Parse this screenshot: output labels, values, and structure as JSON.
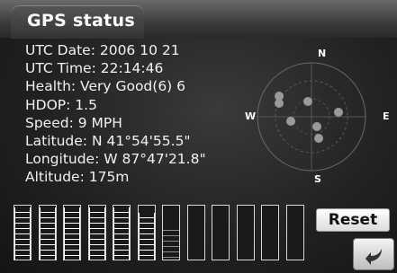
{
  "title": "GPS status",
  "info": [
    "UTC Date: 2006 10 21",
    "UTC Time:  22:14:46",
    "Health: Very Good(6) 6",
    "HDOP: 1.5",
    "Speed: 9 MPH",
    "Latitude: N  41°54'55.5\"",
    "Longitude: W 87°47'21.8\"",
    "Altitude: 175m"
  ],
  "compass": {
    "north": "N",
    "south": "S",
    "east": "E",
    "west": "W"
  },
  "signal_bars": [
    {
      "level": 1.0,
      "state": "tracked"
    },
    {
      "level": 1.0,
      "state": "tracked"
    },
    {
      "level": 1.0,
      "state": "tracked"
    },
    {
      "level": 1.0,
      "state": "tracked"
    },
    {
      "level": 1.0,
      "state": "tracked"
    },
    {
      "level": 0.9,
      "state": "tracked"
    },
    {
      "level": 0.65,
      "state": "searching"
    },
    {
      "level": 0,
      "state": "empty"
    },
    {
      "level": 0,
      "state": "empty"
    },
    {
      "level": 0,
      "state": "empty"
    },
    {
      "level": 0,
      "state": "empty"
    },
    {
      "level": 0,
      "state": "empty"
    }
  ],
  "reset_label": "Reset",
  "back_icon": "back-arrow-icon",
  "colors": {
    "tracked": "#ffffff",
    "searching": "#8a8a8a",
    "satellite": "#9a9a9a"
  }
}
